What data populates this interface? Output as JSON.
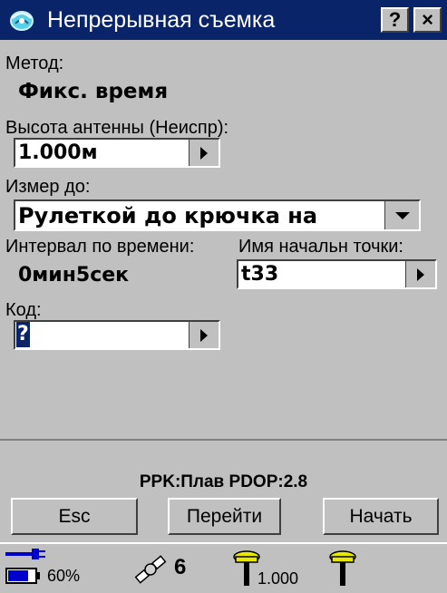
{
  "window": {
    "title": "Непрерывная съемка",
    "help_label": "?",
    "close_label": "×"
  },
  "form": {
    "method_label": "Метод:",
    "method_value": "Фикс. время",
    "antenna_label": "Высота антенны (Неиспр):",
    "antenna_value": "1.000м",
    "measure_to_label": "Измер до:",
    "measure_to_value": "Рулеткой до крючка на",
    "interval_label": "Интервал по времени:",
    "interval_value": "0мин5сек",
    "start_point_label": "Имя начальн точки:",
    "start_point_value": "t33",
    "code_label": "Код:",
    "code_value": "?"
  },
  "status_line": "PPK:Плав PDOP:2.8",
  "buttons": {
    "esc": "Esc",
    "goto": "Перейти",
    "start": "Начать"
  },
  "statusbar": {
    "battery_percent": "60%",
    "satellites": "6",
    "antenna_height": "1.000"
  }
}
